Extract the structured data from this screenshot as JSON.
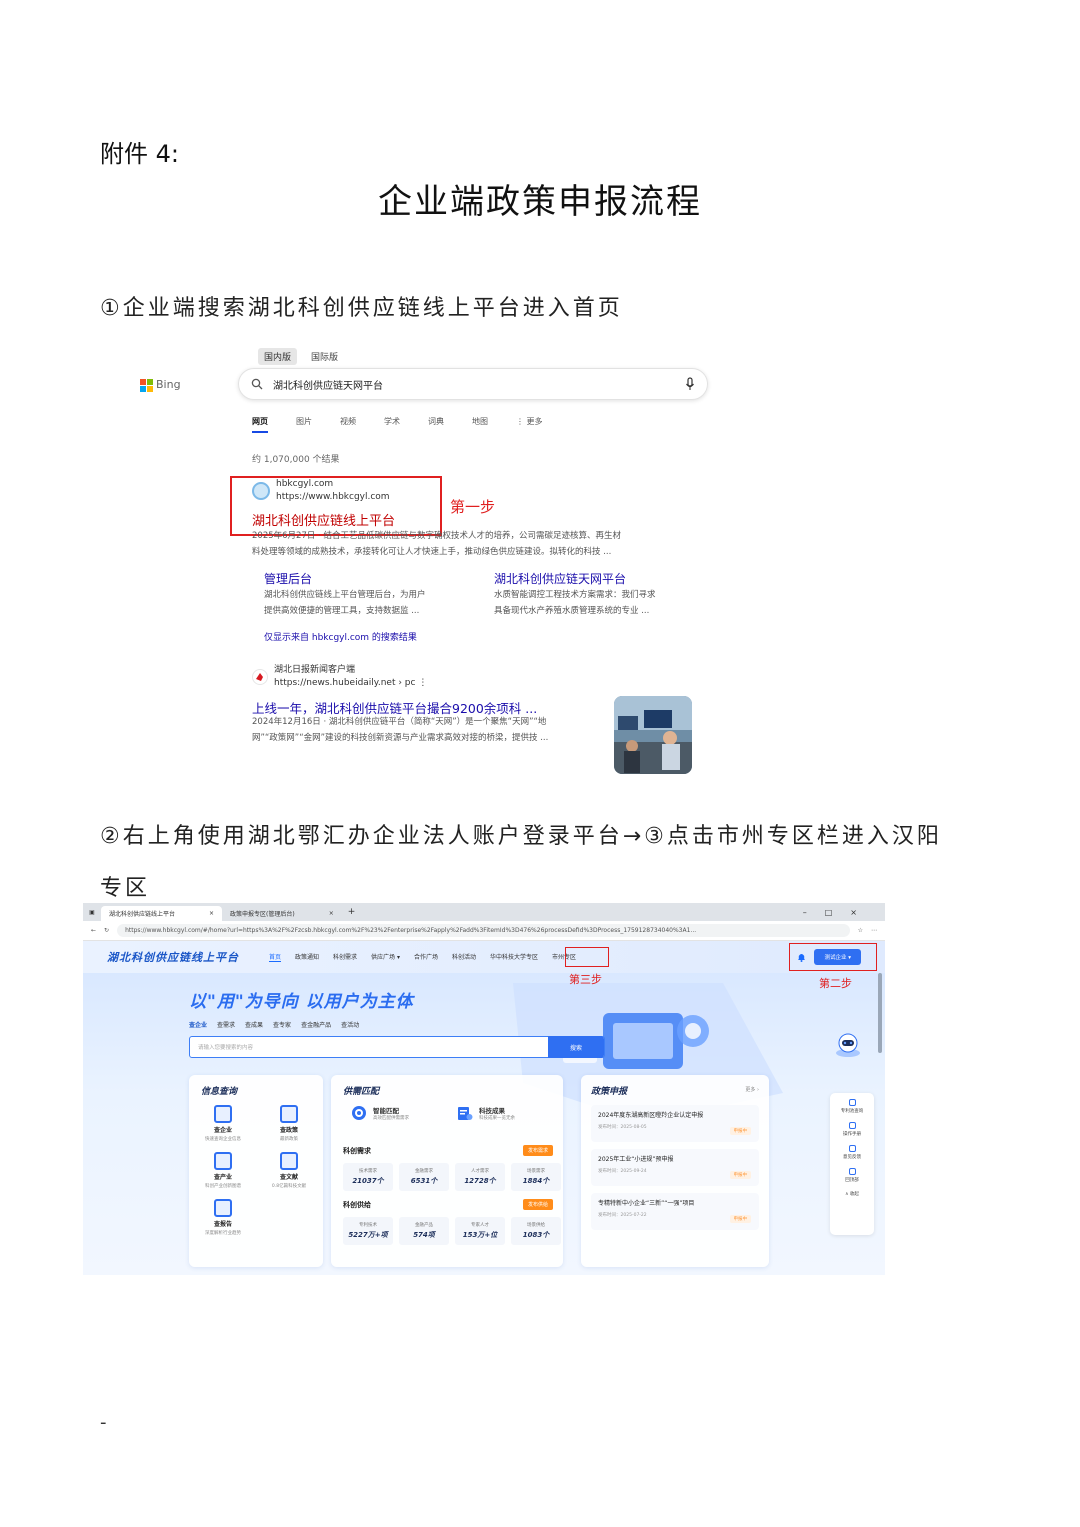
{
  "doc": {
    "attachment": "附件 4:",
    "title": "企业端政策申报流程",
    "step1": "①企业端搜索湖北科创供应链线上平台进入首页",
    "step2_line1": "②右上角使用湖北鄂汇办企业法人账户登录平台→③点击市州专区栏进入汉阳",
    "step2_line2": "专区",
    "page_marker": "-"
  },
  "bing": {
    "logo_text": "Bing",
    "scope_tabs": [
      "国内版",
      "国际版"
    ],
    "query": "湖北科创供应链天网平台",
    "nav_tabs": [
      "网页",
      "图片",
      "视频",
      "学术",
      "词典",
      "地图",
      "⋮ 更多"
    ],
    "result_count": "约 1,070,000 个结果",
    "result1": {
      "site": "hbkcgyl.com",
      "url": "https://www.hbkcgyl.com",
      "title": "湖北科创供应链线上平台",
      "snippet1": "2025年6月27日 · 结合工艺品低碳供应链与数字确权技术人才的培养，公司需碳足迹核算、再生材",
      "snippet2": "料处理等领域的成熟技术，承接转化可让人才快速上手，推动绿色供应链建设。拟转化的科技 ..."
    },
    "step_label": "第一步",
    "sub1": {
      "title": "管理后台",
      "line1": "湖北科创供应链线上平台管理后台，为用户",
      "line2": "提供高效便捷的管理工具，支持数据监 ..."
    },
    "sub2": {
      "title": "湖北科创供应链天网平台",
      "line1": "水质智能调控工程技术方案需求：我们寻求",
      "line2": "具备现代水产养殖水质管理系统的专业 ..."
    },
    "only_link": "仅显示来自 hbkcgyl.com 的搜索结果",
    "result2": {
      "site": "湖北日报新闻客户端",
      "url": "https://news.hubeidaily.net › pc ⋮",
      "title": "上线一年，湖北科创供应链平台撮合9200余项科 ...",
      "snippet1": "2024年12月16日 · 湖北科创供应链平台（简称“天网”）是一个聚焦“天网”“地",
      "snippet2": "网”“政策网”“金网”建设的科技创新资源与产业需求高效对接的桥梁，提供技 ..."
    }
  },
  "platform": {
    "tabs": [
      "湖北科创供应链线上平台",
      "政策申报专区(管理后台)"
    ],
    "url": "https://www.hbkcgyl.com/#/home?url=https%3A%2F%2Fzcsb.hbkcgyl.com%2F%23%2Fenterprise%2Fapply%2Fadd%3FitemId%3D476%26processDefId%3DProcess_1759128734040%3A1...",
    "logo": "湖北科创供应链线上平台",
    "menu": [
      "首页",
      "政策通知",
      "科创需求",
      "供应广场 ▾",
      "合作广场",
      "科创活动",
      "华中科技大学专区",
      "市州专区"
    ],
    "user": "测试企业 ▾",
    "step2_label": "第二步",
    "step3_label": "第三步",
    "slogan": "以\"用\"为导向 以用户为主体",
    "query_tabs": [
      "查企业",
      "查需求",
      "查成果",
      "查专家",
      "查金融产品",
      "查活动"
    ],
    "search_placeholder": "请输入您要搜索的内容",
    "search_button": "搜索",
    "info": {
      "title": "信息查询",
      "tools": [
        {
          "name": "查企业",
          "sub": "快速查询企业信息"
        },
        {
          "name": "查政策",
          "sub": "最新政策"
        },
        {
          "name": "查产业",
          "sub": "科创产业创新图谱"
        },
        {
          "name": "查文献",
          "sub": "0.8亿篇科技文献"
        },
        {
          "name": "查报告",
          "sub": "深度解析行业趋势"
        }
      ]
    },
    "match": {
      "title": "供需匹配",
      "smart": "智能匹配",
      "smart_sub": "高效匹配供需需求",
      "results": "科技成果",
      "results_sub": "科技成果一览无余",
      "demand": {
        "label": "科创需求",
        "tag": "发布需求",
        "cells": [
          {
            "label": "技术需求",
            "value": "21037个"
          },
          {
            "label": "金融需求",
            "value": "6531个"
          },
          {
            "label": "人才需求",
            "value": "12728个"
          },
          {
            "label": "场景需求",
            "value": "1884个"
          }
        ]
      },
      "supply": {
        "label": "科创供给",
        "tag": "发布供给",
        "cells": [
          {
            "label": "专利技术",
            "value": "5227万+项"
          },
          {
            "label": "金融产品",
            "value": "574项"
          },
          {
            "label": "专家人才",
            "value": "153万+位"
          },
          {
            "label": "场景供给",
            "value": "1083个"
          }
        ]
      }
    },
    "policy": {
      "title": "政策申报",
      "more": "更多 ›",
      "items": [
        {
          "title": "2024年度东湖高新区瞪羚企业认定申报",
          "date": "发布时间：2025-08-05",
          "status": "申报中"
        },
        {
          "title": "2025年工业“小进规”预申报",
          "date": "发布时间：2025-09-24",
          "status": "申报中"
        },
        {
          "title": "专精特新中小企业“三新”“一强”项目",
          "date": "发布时间：2025-07-22",
          "status": "申报中"
        }
      ]
    },
    "sidebar": [
      "专利池查询",
      "操作手册",
      "意见反馈",
      "回顶部",
      "∧ 收起"
    ]
  }
}
